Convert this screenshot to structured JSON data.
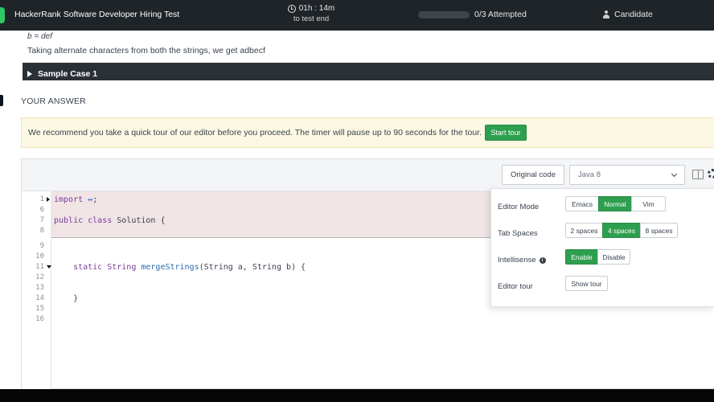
{
  "header": {
    "title": "HackerRank Software Developer Hiring Test",
    "timer_value": "01h : 14m",
    "timer_caption": "to test end",
    "attempted": "0/3 Attempted",
    "progress_fraction": 0,
    "user": "Candidate"
  },
  "problem": {
    "cut_line": "b = def",
    "explanation": "Taking alternate characters from both the strings, we get adbecf",
    "sample_case_label": "Sample Case 1"
  },
  "answer": {
    "heading": "YOUR ANSWER",
    "banner_text": "We recommend you take a quick tour of our editor before you proceed. The timer will pause up to 90 seconds for the tour.",
    "start_tour_label": "Start tour"
  },
  "editor": {
    "original_code_label": "Original code",
    "language": "Java 8",
    "lines": [
      {
        "n": "1",
        "fold": "right",
        "segments": [
          {
            "t": "import ",
            "c": "kw"
          },
          {
            "t": "↔",
            "c": "ell"
          },
          {
            "t": ";",
            "c": ""
          }
        ]
      },
      {
        "n": "6",
        "fold": "",
        "segments": []
      },
      {
        "n": "7",
        "fold": "",
        "segments": [
          {
            "t": "public class ",
            "c": "kw"
          },
          {
            "t": "Solution {",
            "c": ""
          }
        ]
      },
      {
        "n": "8",
        "fold": "",
        "segments": []
      },
      {
        "n": "9",
        "fold": "",
        "segments": []
      },
      {
        "n": "10",
        "fold": "",
        "segments": []
      },
      {
        "n": "11",
        "fold": "down",
        "segments": [
          {
            "t": "    static String ",
            "c": "kw"
          },
          {
            "t": "mergeStrings",
            "c": "fn"
          },
          {
            "t": "(String a, String b) {",
            "c": ""
          }
        ]
      },
      {
        "n": "12",
        "fold": "",
        "segments": []
      },
      {
        "n": "13",
        "fold": "",
        "segments": []
      },
      {
        "n": "14",
        "fold": "",
        "segments": [
          {
            "t": "    }",
            "c": ""
          }
        ]
      },
      {
        "n": "15",
        "fold": "",
        "segments": []
      },
      {
        "n": "16",
        "fold": "",
        "segments": []
      }
    ]
  },
  "settings": {
    "editor_mode_label": "Editor Mode",
    "editor_modes": [
      "Emacs",
      "Normal",
      "Vim"
    ],
    "editor_mode_selected": "Normal",
    "tab_spaces_label": "Tab Spaces",
    "tab_spaces": [
      "2 spaces",
      "4 spaces",
      "8 spaces"
    ],
    "tab_spaces_selected": "4 spaces",
    "intellisense_label": "Intellisense",
    "intellisense_options": [
      "Enable",
      "Disable"
    ],
    "intellisense_selected": "Enable",
    "editor_tour_label": "Editor tour",
    "show_tour_label": "Show tour"
  },
  "colors": {
    "accent": "#2e9e4f",
    "topbar": "#1f2428",
    "banner": "#fcf8e3"
  }
}
